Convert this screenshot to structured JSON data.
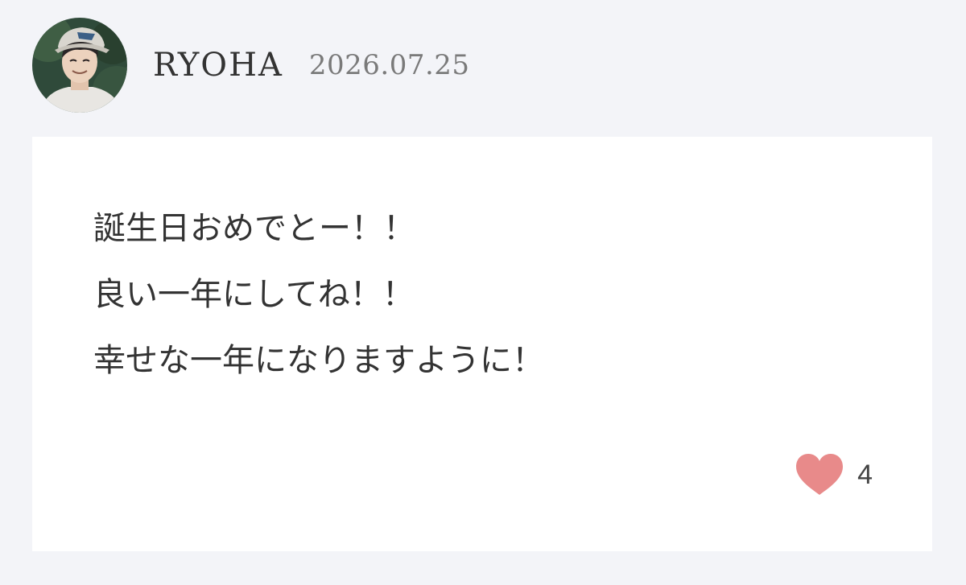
{
  "post": {
    "author": "RYOHA",
    "date": "2026.07.25",
    "message_lines": [
      "誕生日おめでとー！！",
      "良い一年にしてね！！",
      "幸せな一年になりますように！"
    ],
    "likes": {
      "icon": "heart-icon",
      "count": "4",
      "color": "#e88a8a"
    }
  },
  "colors": {
    "background": "#f3f4f8",
    "card": "#ffffff",
    "text": "#333333",
    "date": "#7a7a7a"
  }
}
